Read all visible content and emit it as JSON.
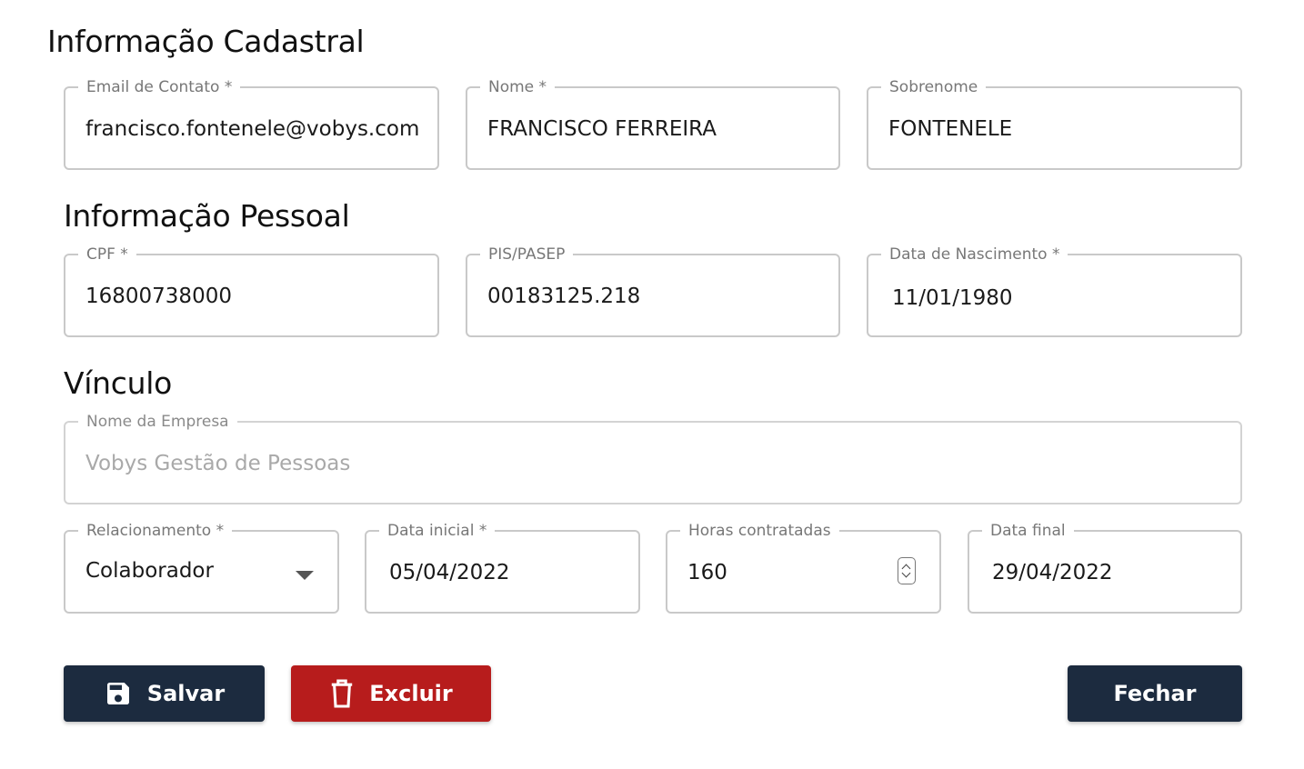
{
  "sections": {
    "cadastral": "Informação Cadastral",
    "pessoal": "Informação Pessoal",
    "vinculo": "Vínculo"
  },
  "fields": {
    "email": {
      "label": "Email de Contato *",
      "value": "francisco.fontenele@vobys.com.b"
    },
    "nome": {
      "label": "Nome *",
      "value": "FRANCISCO FERREIRA"
    },
    "sobrenome": {
      "label": "Sobrenome",
      "value": "FONTENELE"
    },
    "cpf": {
      "label": "CPF *",
      "value": "16800738000"
    },
    "pis": {
      "label": "PIS/PASEP",
      "value": "00183125.218"
    },
    "nascimento": {
      "label": "Data de Nascimento *",
      "value": "11/01/1980"
    },
    "empresa": {
      "label": "Nome da Empresa",
      "value": "Vobys Gestão de Pessoas"
    },
    "relacionamento": {
      "label": "Relacionamento *",
      "value": "Colaborador"
    },
    "data_inicial": {
      "label": "Data inicial *",
      "value": "05/04/2022"
    },
    "horas": {
      "label": "Horas contratadas",
      "value": "160"
    },
    "data_final": {
      "label": "Data final",
      "value": "29/04/2022"
    }
  },
  "buttons": {
    "salvar": "Salvar",
    "excluir": "Excluir",
    "fechar": "Fechar"
  },
  "icons": {
    "salvar": "save-icon",
    "excluir": "trash-icon",
    "relacionamento": "chevron-down-icon",
    "horas": "number-spinner-icon"
  },
  "colors": {
    "primary_dark": "#1c2b3f",
    "danger": "#b71c1c",
    "border": "#c9c9c9",
    "label": "#777777"
  }
}
